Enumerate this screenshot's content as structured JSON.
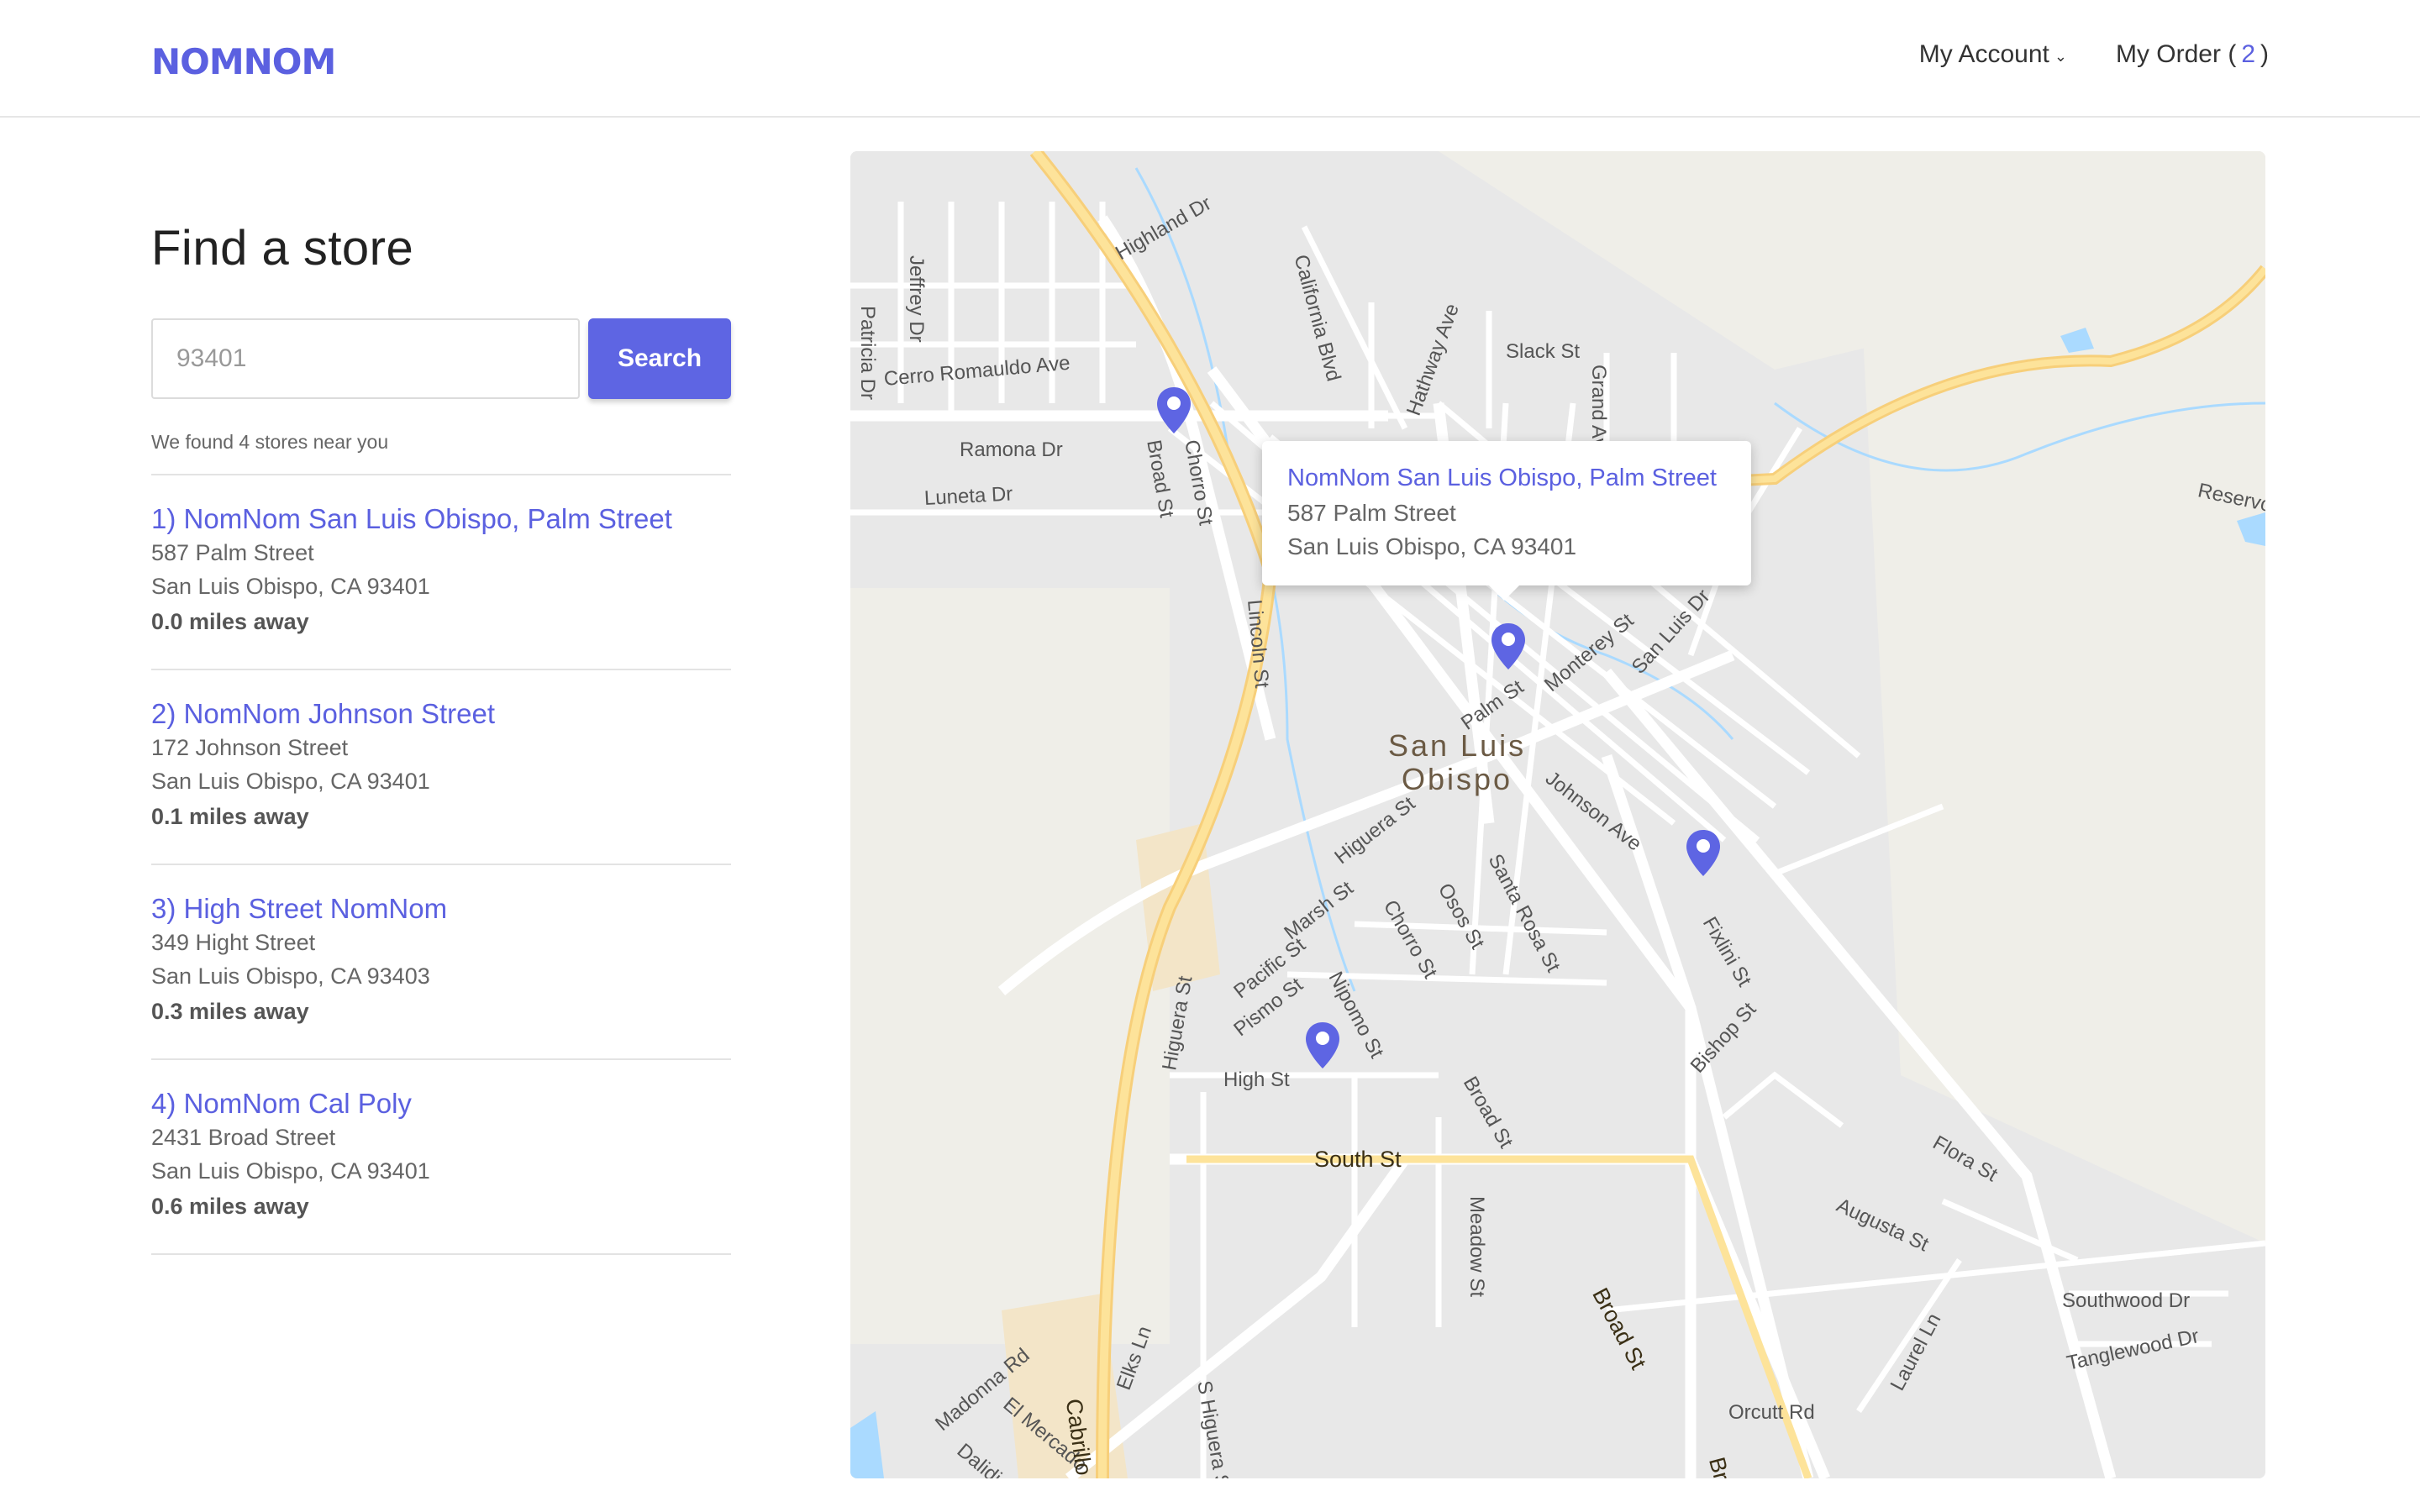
{
  "brand": {
    "name": "NOMNOM",
    "accent": "#5b60e0"
  },
  "nav": {
    "account_label": "My Account",
    "order_label": "My Order (",
    "order_count": "2",
    "order_close": ")"
  },
  "page": {
    "title": "Find a store"
  },
  "search": {
    "value": "93401",
    "button_label": "Search"
  },
  "results": {
    "summary": "We found 4 stores near you",
    "stores": [
      {
        "name": "1) NomNom San Luis Obispo, Palm Street",
        "street": "587 Palm Street",
        "city": "San Luis Obispo, CA 93401",
        "distance": "0.0 miles away"
      },
      {
        "name": "2) NomNom Johnson Street",
        "street": "172 Johnson Street",
        "city": "San Luis Obispo, CA 93401",
        "distance": "0.1 miles away"
      },
      {
        "name": "3) High Street NomNom",
        "street": "349 Hight Street",
        "city": "San Luis Obispo, CA 93403",
        "distance": "0.3 miles away"
      },
      {
        "name": "4) NomNom Cal Poly",
        "street": "2431 Broad Street",
        "city": "San Luis Obispo, CA 93401",
        "distance": "0.6 miles away"
      }
    ]
  },
  "map": {
    "popup": {
      "title": "NomNom San Luis Obispo, Palm Street",
      "street": "587 Palm Street",
      "city": "San Luis Obispo, CA 93401"
    },
    "city_label_1": "San Luis",
    "city_label_2": "Obispo",
    "street_labels": {
      "highland": "Highland Dr",
      "jeffrey": "Jeffrey Dr",
      "patricia": "Patricia Dr",
      "california": "California Blvd",
      "hathway": "Hathway Ave",
      "slack": "Slack St",
      "grand": "Grand Ave",
      "cerro": "Cerro Romauldo Ave",
      "ramona": "Ramona Dr",
      "luneta": "Luneta Dr",
      "broad1": "Broad St",
      "chorro1": "Chorro St",
      "lincoln": "Lincoln St",
      "palm": "Palm St",
      "monterey": "Monterey St",
      "sanluis": "San Luis Dr",
      "johnson": "Johnson Ave",
      "higuera1": "Higuera St",
      "marsh": "Marsh St",
      "chorro2": "Chorro St",
      "osos": "Osos St",
      "santarosa": "Santa Rosa St",
      "fixlini": "Fixlini St",
      "pacific": "Pacific St",
      "pismo": "Pismo St",
      "nipomo": "Nipomo St",
      "higuera2": "Higuera St",
      "high": "High St",
      "broad2": "Broad St",
      "bishop": "Bishop St",
      "south": "South St",
      "meadow": "Meadow St",
      "flora": "Flora St",
      "augusta": "Augusta St",
      "broad3": "Broad St",
      "laurel": "Laurel Ln",
      "southwood": "Southwood Dr",
      "tanglewood": "Tanglewood Dr",
      "madonna": "Madonna Rd",
      "elmercado": "El Mercado",
      "dalidio": "Dalidio Dr",
      "cabrillo": "Cabrillo Hwy",
      "elks": "Elks Ln",
      "shiguera": "S Higuera St",
      "orcutt": "Orcutt Rd",
      "reservoir": "Reservoir",
      "bro": "Bro"
    }
  }
}
